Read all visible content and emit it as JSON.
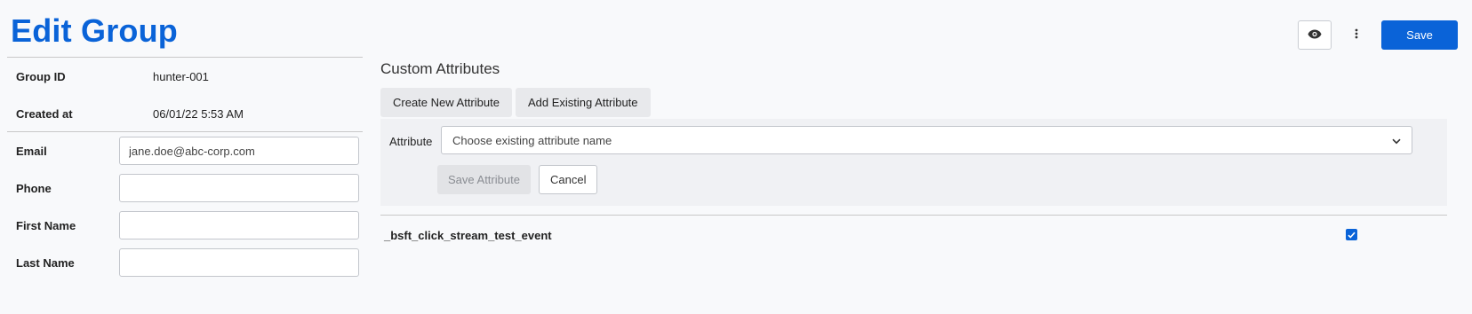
{
  "header": {
    "title": "Edit Group",
    "save_label": "Save"
  },
  "group_info": {
    "group_id_label": "Group ID",
    "group_id_value": "hunter-001",
    "created_label": "Created at",
    "created_value": "06/01/22 5:53 AM"
  },
  "form": {
    "email_label": "Email",
    "email_value": "jane.doe@abc-corp.com",
    "phone_label": "Phone",
    "phone_value": "",
    "first_name_label": "First Name",
    "first_name_value": "",
    "last_name_label": "Last Name",
    "last_name_value": ""
  },
  "custom_attributes": {
    "title": "Custom Attributes",
    "create_new_label": "Create New Attribute",
    "add_existing_label": "Add Existing Attribute",
    "attribute_label": "Attribute",
    "select_placeholder": "Choose existing attribute name",
    "save_attribute_label": "Save Attribute",
    "cancel_label": "Cancel",
    "items": [
      {
        "name": "_bsft_click_stream_test_event",
        "checked": true
      }
    ]
  },
  "colors": {
    "accent": "#0a63d8"
  },
  "icons": {
    "preview": "eye-icon",
    "more": "kebab-menu-icon",
    "dropdown": "chevron-down-icon",
    "check": "checkmark-icon"
  }
}
